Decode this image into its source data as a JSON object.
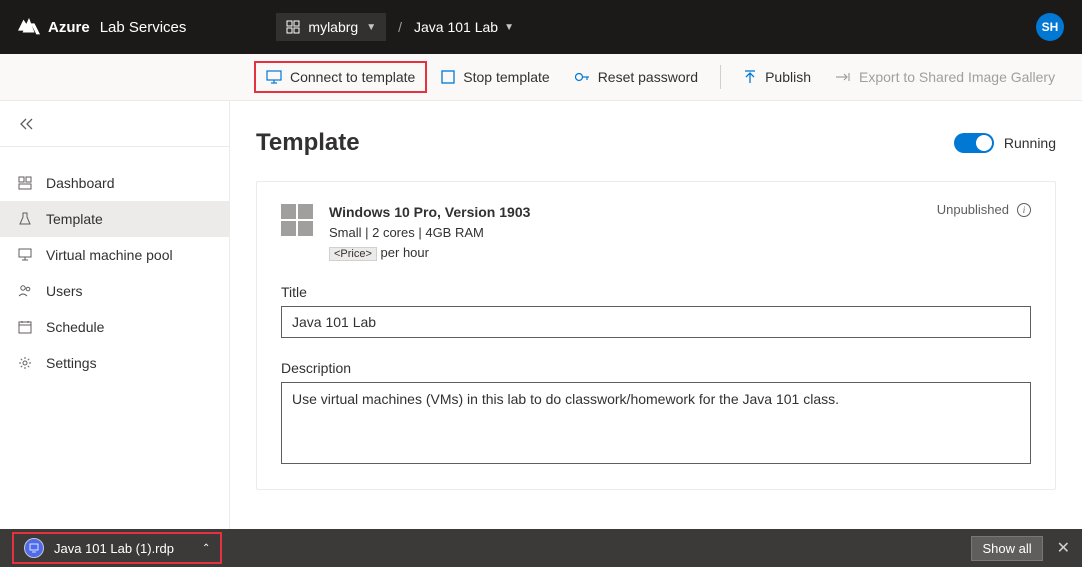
{
  "header": {
    "brand_strong": "Azure",
    "brand_light": "Lab Services",
    "rg_name": "mylabrg",
    "lab_name": "Java 101 Lab",
    "avatar_initials": "SH",
    "separator": "/"
  },
  "toolbar": {
    "connect": "Connect to template",
    "stop": "Stop template",
    "reset": "Reset password",
    "publish": "Publish",
    "export": "Export to Shared Image Gallery"
  },
  "sidebar": {
    "items": [
      {
        "label": "Dashboard",
        "icon": "dashboard"
      },
      {
        "label": "Template",
        "icon": "flask"
      },
      {
        "label": "Virtual machine pool",
        "icon": "monitor"
      },
      {
        "label": "Users",
        "icon": "users"
      },
      {
        "label": "Schedule",
        "icon": "calendar"
      },
      {
        "label": "Settings",
        "icon": "gear"
      }
    ]
  },
  "main": {
    "page_title": "Template",
    "toggle_label": "Running",
    "os_title": "Windows 10 Pro, Version 1903",
    "spec_line": "Small | 2 cores | 4GB RAM",
    "price_badge": "<Price>",
    "price_suffix": "per hour",
    "publish_status": "Unpublished",
    "title_label": "Title",
    "title_value": "Java 101 Lab",
    "desc_label": "Description",
    "desc_value": "Use virtual machines (VMs) in this lab to do classwork/homework for the Java 101 class."
  },
  "downloadbar": {
    "file_name": "Java 101 Lab (1).rdp",
    "show_all": "Show all"
  }
}
